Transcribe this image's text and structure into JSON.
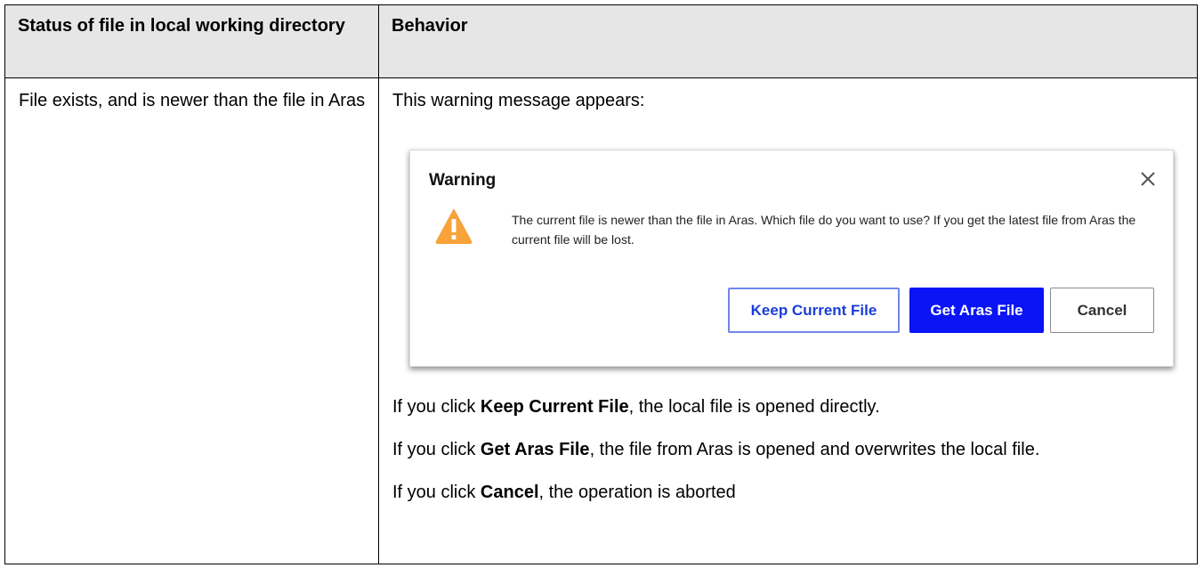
{
  "table": {
    "header_col1": "Status of file in local working directory",
    "header_col2": "Behavior",
    "status_text": "File exists, and is newer than the file in Aras",
    "intro_text": "This warning message appears:"
  },
  "dialog": {
    "title": "Warning",
    "close_icon": "close-icon",
    "warning_icon": "warning-triangle-icon",
    "warning_color": "#f7a33a",
    "message": "The current file is newer than the file in Aras. Which file do you want to use? If you get the latest file from Aras the current file will be lost.",
    "buttons": {
      "keep": "Keep Current File",
      "get": "Get Aras File",
      "cancel": "Cancel"
    },
    "primary_color": "#0a14f5"
  },
  "outcomes": {
    "keep": {
      "prefix": "If you click ",
      "label": "Keep Current File",
      "suffix": ", the local file is opened directly."
    },
    "get": {
      "prefix": "If you click ",
      "label": "Get Aras File",
      "suffix": ", the file from Aras is opened and overwrites the local file."
    },
    "cancel": {
      "prefix": "If you click ",
      "label": "Cancel",
      "suffix": ", the operation is aborted"
    }
  }
}
